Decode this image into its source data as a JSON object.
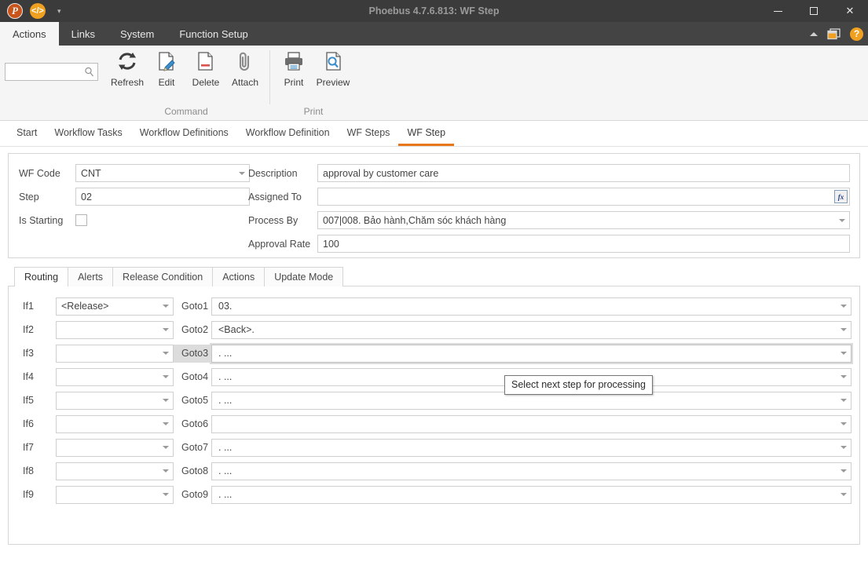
{
  "window": {
    "title": "Phoebus 4.7.6.813: WF Step",
    "minimize": "–",
    "maximize": "□",
    "close": "✕",
    "qat": {
      "app_badge": "P",
      "code_badge": "</>",
      "dropdown_caret": "▾"
    }
  },
  "menu": {
    "tabs": [
      {
        "label": "Actions",
        "active": true
      },
      {
        "label": "Links",
        "active": false
      },
      {
        "label": "System",
        "active": false
      },
      {
        "label": "Function Setup",
        "active": false
      }
    ],
    "help_label": "?"
  },
  "search": {
    "value": "",
    "placeholder": ""
  },
  "ribbon": {
    "groups": [
      {
        "title": "Command",
        "items": [
          {
            "label": "Refresh",
            "icon": "refresh-icon"
          },
          {
            "label": "Edit",
            "icon": "edit-icon"
          },
          {
            "label": "Delete",
            "icon": "delete-icon"
          },
          {
            "label": "Attach",
            "icon": "attach-icon"
          }
        ]
      },
      {
        "title": "Print",
        "items": [
          {
            "label": "Print",
            "icon": "printer-icon"
          },
          {
            "label": "Preview",
            "icon": "preview-icon"
          }
        ]
      }
    ]
  },
  "navtabs": [
    {
      "label": "Start",
      "active": false
    },
    {
      "label": "Workflow Tasks",
      "active": false
    },
    {
      "label": "Workflow Definitions",
      "active": false
    },
    {
      "label": "Workflow Definition",
      "active": false
    },
    {
      "label": "WF Steps",
      "active": false
    },
    {
      "label": "WF Step",
      "active": true
    }
  ],
  "form": {
    "left": [
      {
        "label": "WF Code",
        "value": "CNT",
        "type": "combo"
      },
      {
        "label": "Step",
        "value": "02",
        "type": "text"
      },
      {
        "label": "Is Starting",
        "value": "",
        "type": "checkbox",
        "checked": false
      }
    ],
    "right": [
      {
        "label": "Description",
        "value": "approval by customer care",
        "type": "text"
      },
      {
        "label": "Assigned To",
        "value": "",
        "type": "text-fx",
        "fx_label": "fx"
      },
      {
        "label": "Process By",
        "value": "007|008. Bảo hành,Chăm sóc khách hàng",
        "type": "combo"
      },
      {
        "label": "Approval Rate",
        "value": "100",
        "type": "text"
      }
    ]
  },
  "subtabs": [
    {
      "label": "Routing",
      "active": true
    },
    {
      "label": "Alerts",
      "active": false
    },
    {
      "label": "Release Condition",
      "active": false
    },
    {
      "label": "Actions",
      "active": false
    },
    {
      "label": "Update Mode",
      "active": false
    }
  ],
  "routing": {
    "rows": [
      {
        "if_label": "If1",
        "if_value": "<Release>",
        "goto_label": "Goto1",
        "goto_value": "03.",
        "highlighted": false
      },
      {
        "if_label": "If2",
        "if_value": "",
        "goto_label": "Goto2",
        "goto_value": "<Back>.",
        "highlighted": false
      },
      {
        "if_label": "If3",
        "if_value": "",
        "goto_label": "Goto3",
        "goto_value": ". ...",
        "highlighted": true
      },
      {
        "if_label": "If4",
        "if_value": "",
        "goto_label": "Goto4",
        "goto_value": ". ...",
        "highlighted": false
      },
      {
        "if_label": "If5",
        "if_value": "",
        "goto_label": "Goto5",
        "goto_value": ". ...",
        "highlighted": false
      },
      {
        "if_label": "If6",
        "if_value": "",
        "goto_label": "Goto6",
        "goto_value": "",
        "highlighted": false
      },
      {
        "if_label": "If7",
        "if_value": "",
        "goto_label": "Goto7",
        "goto_value": ". ...",
        "highlighted": false
      },
      {
        "if_label": "If8",
        "if_value": "",
        "goto_label": "Goto8",
        "goto_value": ". ...",
        "highlighted": false
      },
      {
        "if_label": "If9",
        "if_value": "",
        "goto_label": "Goto9",
        "goto_value": ". ...",
        "highlighted": false
      }
    ]
  },
  "tooltip": {
    "text": "Select next step for processing"
  },
  "colors": {
    "titlebar": "#3b3b3b",
    "menubar": "#444444",
    "accent": "#e8761b",
    "badge": "#f0a020",
    "ribbon": "#f5f5f5"
  }
}
